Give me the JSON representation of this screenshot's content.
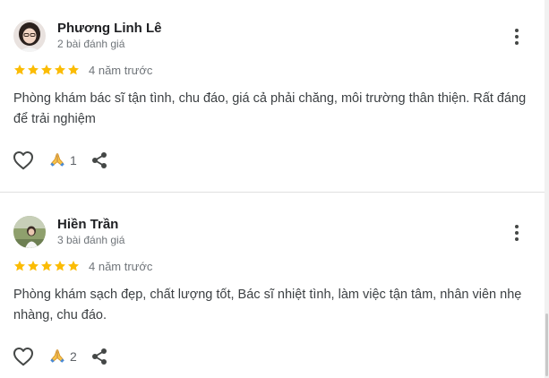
{
  "reviews": [
    {
      "author": "Phương Linh Lê",
      "review_count": "2 bài đánh giá",
      "rating": 5,
      "date": "4 năm trước",
      "text": "Phòng khám bác sĩ tận tình, chu đáo, giá cả phải chăng, môi trường thân thiện. Rất đáng để trải nghiệm",
      "thanks_count": "1",
      "icons": {
        "like": "heart-outline-icon",
        "thanks": "folded-hands-emoji",
        "share": "share-icon",
        "more": "more-vert-icon"
      }
    },
    {
      "author": "Hiền Trần",
      "review_count": "3 bài đánh giá",
      "rating": 5,
      "date": "4 năm trước",
      "text": "Phòng khám sạch đẹp, chất lượng tốt, Bác sĩ nhiệt tình, làm việc tận tâm, nhân viên nhẹ nhàng, chu đáo.",
      "thanks_count": "2",
      "icons": {
        "like": "heart-outline-icon",
        "thanks": "folded-hands-emoji",
        "share": "share-icon",
        "more": "more-vert-icon"
      }
    }
  ],
  "colors": {
    "star": "#fbbc04",
    "text": "#3c4043",
    "muted": "#70757a",
    "icon": "#444746",
    "divider": "#e0e0e0"
  }
}
